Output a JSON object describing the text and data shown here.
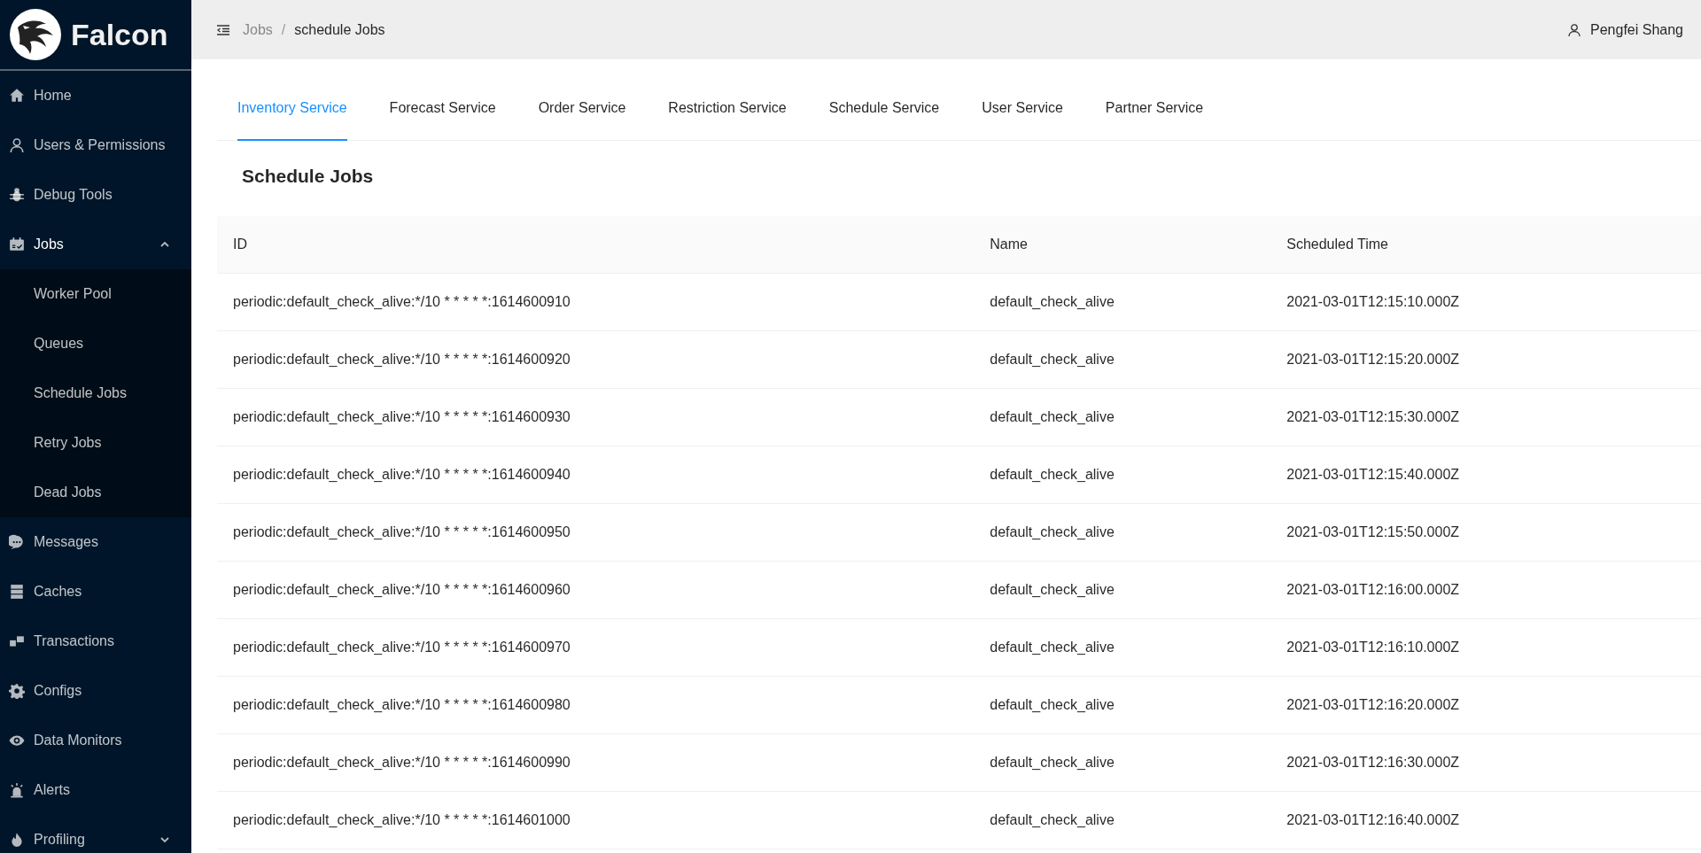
{
  "sidebar": {
    "logo": "Falcon",
    "items": [
      {
        "label": "Home"
      },
      {
        "label": "Users & Permissions"
      },
      {
        "label": "Debug Tools"
      },
      {
        "label": "Jobs",
        "expanded": true,
        "children": [
          {
            "label": "Worker Pool"
          },
          {
            "label": "Queues"
          },
          {
            "label": "Schedule Jobs"
          },
          {
            "label": "Retry Jobs"
          },
          {
            "label": "Dead Jobs"
          }
        ]
      },
      {
        "label": "Messages"
      },
      {
        "label": "Caches"
      },
      {
        "label": "Transactions"
      },
      {
        "label": "Configs"
      },
      {
        "label": "Data Monitors"
      },
      {
        "label": "Alerts"
      },
      {
        "label": "Profiling",
        "expanded": false
      }
    ]
  },
  "header": {
    "breadcrumb": [
      "Jobs",
      "schedule Jobs"
    ],
    "separator": "/",
    "user": "Pengfei Shang"
  },
  "tabs": [
    {
      "label": "Inventory Service",
      "selected": true
    },
    {
      "label": "Forecast Service",
      "selected": false
    },
    {
      "label": "Order Service",
      "selected": false
    },
    {
      "label": "Restriction Service",
      "selected": false
    },
    {
      "label": "Schedule Service",
      "selected": false
    },
    {
      "label": "User Service",
      "selected": false
    },
    {
      "label": "Partner Service",
      "selected": false
    }
  ],
  "title": "Schedule Jobs",
  "table": {
    "columns": [
      "ID",
      "Name",
      "Scheduled Time"
    ],
    "rows": [
      [
        "periodic:default_check_alive:*/10 * * * * *:1614600910",
        "default_check_alive",
        "2021-03-01T12:15:10.000Z"
      ],
      [
        "periodic:default_check_alive:*/10 * * * * *:1614600920",
        "default_check_alive",
        "2021-03-01T12:15:20.000Z"
      ],
      [
        "periodic:default_check_alive:*/10 * * * * *:1614600930",
        "default_check_alive",
        "2021-03-01T12:15:30.000Z"
      ],
      [
        "periodic:default_check_alive:*/10 * * * * *:1614600940",
        "default_check_alive",
        "2021-03-01T12:15:40.000Z"
      ],
      [
        "periodic:default_check_alive:*/10 * * * * *:1614600950",
        "default_check_alive",
        "2021-03-01T12:15:50.000Z"
      ],
      [
        "periodic:default_check_alive:*/10 * * * * *:1614600960",
        "default_check_alive",
        "2021-03-01T12:16:00.000Z"
      ],
      [
        "periodic:default_check_alive:*/10 * * * * *:1614600970",
        "default_check_alive",
        "2021-03-01T12:16:10.000Z"
      ],
      [
        "periodic:default_check_alive:*/10 * * * * *:1614600980",
        "default_check_alive",
        "2021-03-01T12:16:20.000Z"
      ],
      [
        "periodic:default_check_alive:*/10 * * * * *:1614600990",
        "default_check_alive",
        "2021-03-01T12:16:30.000Z"
      ],
      [
        "periodic:default_check_alive:*/10 * * * * *:1614601000",
        "default_check_alive",
        "2021-03-01T12:16:40.000Z"
      ]
    ]
  }
}
